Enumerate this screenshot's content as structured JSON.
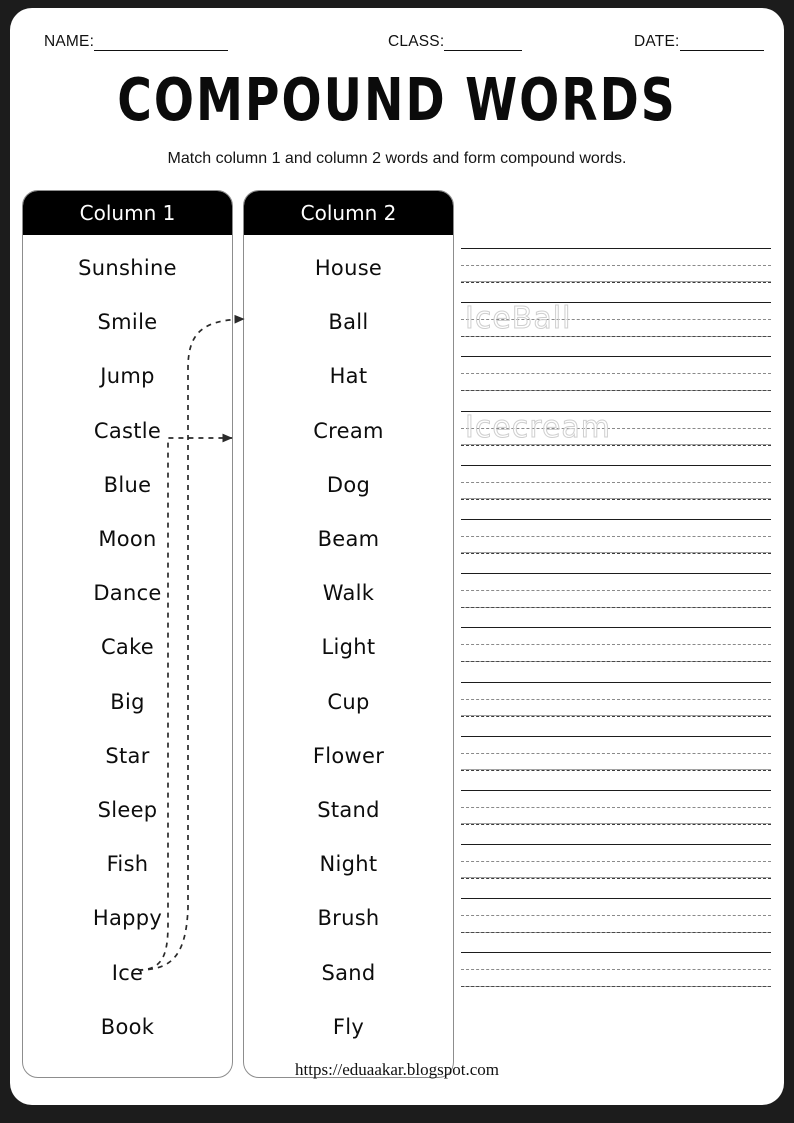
{
  "header": {
    "name_label": "NAME:",
    "class_label": "CLASS:",
    "date_label": "DATE:"
  },
  "title": "COMPOUND WORDS",
  "subtitle": "Match column 1 and column 2 words and form compound words.",
  "columns": [
    {
      "heading": "Column 1",
      "words": [
        "Sunshine",
        "Smile",
        "Jump",
        "Castle",
        "Blue",
        "Moon",
        "Dance",
        "Cake",
        "Big",
        "Star",
        "Sleep",
        "Fish",
        "Happy",
        "Ice",
        "Book"
      ]
    },
    {
      "heading": "Column 2",
      "words": [
        "House",
        "Ball",
        "Hat",
        "Cream",
        "Dog",
        "Beam",
        "Walk",
        "Light",
        "Cup",
        "Flower",
        "Stand",
        "Night",
        "Brush",
        "Sand",
        "Fly"
      ]
    }
  ],
  "matches": [
    {
      "from": "Ice",
      "to": "Ball"
    },
    {
      "from": "Ice",
      "to": "Cream"
    }
  ],
  "answer_lines": {
    "count": 14,
    "traced": [
      {
        "line_index": 1,
        "text": "IceBall"
      },
      {
        "line_index": 3,
        "text": "Icecream"
      }
    ]
  },
  "footer": "https://eduaakar.blogspot.com",
  "colors": {
    "frame": "#1c1c1c",
    "paper": "#ffffff",
    "header_bar": "#000000",
    "header_text": "#ffffff",
    "box_border": "#8d8d8d",
    "trace_text": "#cfcfcf"
  }
}
